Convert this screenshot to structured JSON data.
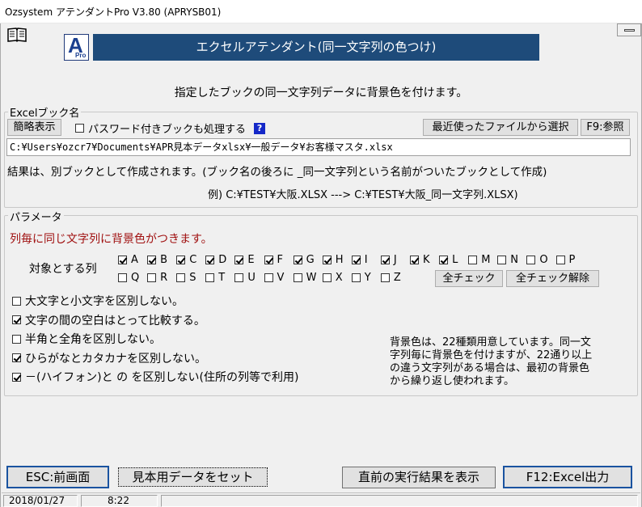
{
  "window": {
    "title": "Ozsystem アテンダントPro V3.80 (APRYSB01)"
  },
  "logo": {
    "letter": "A",
    "sub": "Pro"
  },
  "banner": {
    "title": "エクセルアテンダント(同一文字列の色つけ)"
  },
  "description": "指定したブックの同一文字列データに背景色を付けます。",
  "excel_group": {
    "legend": "Excelブック名",
    "display_button": "簡略表示",
    "password_checkbox": {
      "label": "パスワード付きブックも処理する",
      "checked": false
    },
    "help_icon": "?",
    "recent_button": "最近使ったファイルから選択",
    "browse_button": "F9:参照",
    "path_value": "C:¥Users¥ozcr7¥Documents¥APR見本データxlsx¥一般データ¥お客様マスタ.xlsx",
    "note1": "結果は、別ブックとして作成されます。(ブック名の後ろに _同一文字列という名前がついたブックとして作成)",
    "note2": "例) C:¥TEST¥大阪.XLSX ---> C:¥TEST¥大阪_同一文字列.XLSX)"
  },
  "params_group": {
    "legend": "パラメータ",
    "headline": "列毎に同じ文字列に背景色がつきます。",
    "target_label": "対象とする列",
    "columns_row1": [
      {
        "label": "A",
        "checked": true
      },
      {
        "label": "B",
        "checked": true
      },
      {
        "label": "C",
        "checked": true
      },
      {
        "label": "D",
        "checked": true
      },
      {
        "label": "E",
        "checked": true
      },
      {
        "label": "F",
        "checked": true
      },
      {
        "label": "G",
        "checked": true
      },
      {
        "label": "H",
        "checked": true
      },
      {
        "label": "I",
        "checked": true
      },
      {
        "label": "J",
        "checked": true
      },
      {
        "label": "K",
        "checked": true
      },
      {
        "label": "L",
        "checked": true
      },
      {
        "label": "M",
        "checked": false
      },
      {
        "label": "N",
        "checked": false
      },
      {
        "label": "O",
        "checked": false
      },
      {
        "label": "P",
        "checked": false
      }
    ],
    "columns_row2": [
      {
        "label": "Q",
        "checked": false
      },
      {
        "label": "R",
        "checked": false
      },
      {
        "label": "S",
        "checked": false
      },
      {
        "label": "T",
        "checked": false
      },
      {
        "label": "U",
        "checked": false
      },
      {
        "label": "V",
        "checked": false
      },
      {
        "label": "W",
        "checked": false
      },
      {
        "label": "X",
        "checked": false
      },
      {
        "label": "Y",
        "checked": false
      },
      {
        "label": "Z",
        "checked": false
      }
    ],
    "check_all_button": "全チェック",
    "uncheck_all_button": "全チェック解除",
    "options": [
      {
        "label": "大文字と小文字を区別しない。",
        "checked": false
      },
      {
        "label": "文字の間の空白はとって比較する。",
        "checked": true
      },
      {
        "label": "半角と全角を区別しない。",
        "checked": false
      },
      {
        "label": "ひらがなとカタカナを区別しない。",
        "checked": true
      },
      {
        "label": "－(ハイフォン)と の を区別しない(住所の列等で利用)",
        "checked": true
      }
    ],
    "info_lines": [
      "背景色は、22種類用意しています。同一文",
      "字列毎に背景色を付けますが、22通り以上",
      "の違う文字列がある場合は、最初の背景色",
      "から繰り返し使われます。"
    ]
  },
  "bottom_buttons": {
    "back": "ESC:前画面",
    "sample": "見本用データをセット",
    "last_result": "直前の実行結果を表示",
    "export": "F12:Excel出力"
  },
  "statusbar": {
    "date": "2018/01/27",
    "time": "8:22"
  }
}
